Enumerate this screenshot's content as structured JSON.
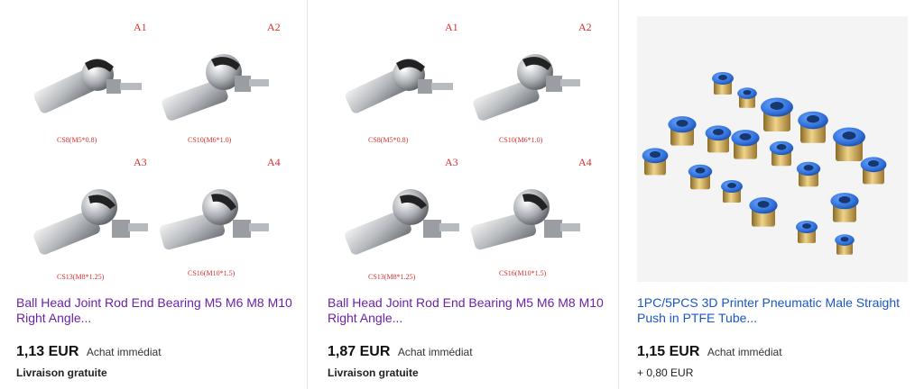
{
  "listings": [
    {
      "title": "Ball Head Joint Rod End Bearing M5 M6 M8 M10 Right Angle...",
      "price": "1,13 EUR",
      "buy_format": "Achat immédiat",
      "shipping": "Livraison gratuite",
      "image_labels": {
        "a1": "A1",
        "a2": "A2",
        "a3": "A3",
        "a4": "A4",
        "cs8": "CS8(M5*0.8)",
        "cs10": "CS10(M6*1.0)",
        "cs13": "CS13(M8*1.25)",
        "cs16": "CS16(M10*1.5)"
      }
    },
    {
      "title": "Ball Head Joint Rod End Bearing M5 M6 M8 M10 Right Angle...",
      "price": "1,87 EUR",
      "buy_format": "Achat immédiat",
      "shipping": "Livraison gratuite",
      "image_labels": {
        "a1": "A1",
        "a2": "A2",
        "a3": "A3",
        "a4": "A4",
        "cs8": "CS8(M5*0.8)",
        "cs10": "CS10(M6*1.0)",
        "cs13": "CS13(M8*1.25)",
        "cs16": "CS16(M10*1.5)"
      }
    },
    {
      "title": "1PC/5PCS 3D Printer Pneumatic Male Straight Push in PTFE Tube...",
      "price": "1,15 EUR",
      "buy_format": "Achat immédiat",
      "shipping": "+ 0,80 EUR"
    }
  ],
  "colors": {
    "title_visited": "#6b21a8",
    "title_link": "#1a56c4",
    "label_red": "#d43030",
    "fitting_blue": "#2f6fd8",
    "fitting_brass": "#c9a14a"
  },
  "icons": [
    "ball-joint-product-image",
    "pneumatic-fitting-product-image"
  ]
}
